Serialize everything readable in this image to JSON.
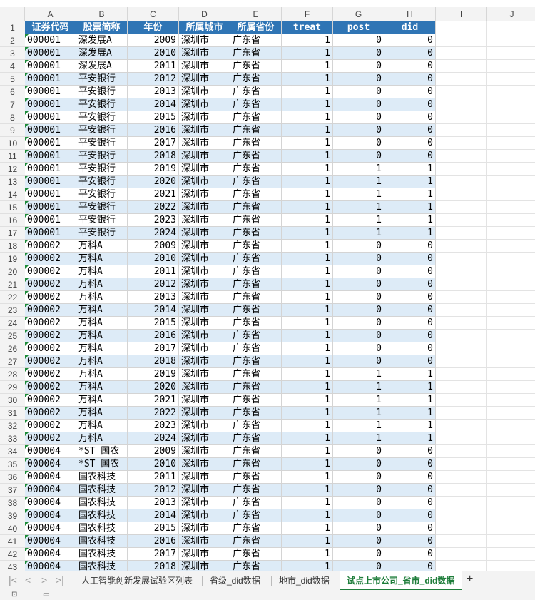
{
  "columns": [
    "A",
    "B",
    "C",
    "D",
    "E",
    "F",
    "G",
    "H",
    "I",
    "J"
  ],
  "headers": [
    "证券代码",
    "股票简称",
    "年份",
    "所属城市",
    "所属省份",
    "treat",
    "post",
    "did"
  ],
  "rows": [
    [
      "000001",
      "深发展A",
      "2009",
      "深圳市",
      "广东省",
      "1",
      "0",
      "0"
    ],
    [
      "000001",
      "深发展A",
      "2010",
      "深圳市",
      "广东省",
      "1",
      "0",
      "0"
    ],
    [
      "000001",
      "深发展A",
      "2011",
      "深圳市",
      "广东省",
      "1",
      "0",
      "0"
    ],
    [
      "000001",
      "平安银行",
      "2012",
      "深圳市",
      "广东省",
      "1",
      "0",
      "0"
    ],
    [
      "000001",
      "平安银行",
      "2013",
      "深圳市",
      "广东省",
      "1",
      "0",
      "0"
    ],
    [
      "000001",
      "平安银行",
      "2014",
      "深圳市",
      "广东省",
      "1",
      "0",
      "0"
    ],
    [
      "000001",
      "平安银行",
      "2015",
      "深圳市",
      "广东省",
      "1",
      "0",
      "0"
    ],
    [
      "000001",
      "平安银行",
      "2016",
      "深圳市",
      "广东省",
      "1",
      "0",
      "0"
    ],
    [
      "000001",
      "平安银行",
      "2017",
      "深圳市",
      "广东省",
      "1",
      "0",
      "0"
    ],
    [
      "000001",
      "平安银行",
      "2018",
      "深圳市",
      "广东省",
      "1",
      "0",
      "0"
    ],
    [
      "000001",
      "平安银行",
      "2019",
      "深圳市",
      "广东省",
      "1",
      "1",
      "1"
    ],
    [
      "000001",
      "平安银行",
      "2020",
      "深圳市",
      "广东省",
      "1",
      "1",
      "1"
    ],
    [
      "000001",
      "平安银行",
      "2021",
      "深圳市",
      "广东省",
      "1",
      "1",
      "1"
    ],
    [
      "000001",
      "平安银行",
      "2022",
      "深圳市",
      "广东省",
      "1",
      "1",
      "1"
    ],
    [
      "000001",
      "平安银行",
      "2023",
      "深圳市",
      "广东省",
      "1",
      "1",
      "1"
    ],
    [
      "000001",
      "平安银行",
      "2024",
      "深圳市",
      "广东省",
      "1",
      "1",
      "1"
    ],
    [
      "000002",
      "万科A",
      "2009",
      "深圳市",
      "广东省",
      "1",
      "0",
      "0"
    ],
    [
      "000002",
      "万科A",
      "2010",
      "深圳市",
      "广东省",
      "1",
      "0",
      "0"
    ],
    [
      "000002",
      "万科A",
      "2011",
      "深圳市",
      "广东省",
      "1",
      "0",
      "0"
    ],
    [
      "000002",
      "万科A",
      "2012",
      "深圳市",
      "广东省",
      "1",
      "0",
      "0"
    ],
    [
      "000002",
      "万科A",
      "2013",
      "深圳市",
      "广东省",
      "1",
      "0",
      "0"
    ],
    [
      "000002",
      "万科A",
      "2014",
      "深圳市",
      "广东省",
      "1",
      "0",
      "0"
    ],
    [
      "000002",
      "万科A",
      "2015",
      "深圳市",
      "广东省",
      "1",
      "0",
      "0"
    ],
    [
      "000002",
      "万科A",
      "2016",
      "深圳市",
      "广东省",
      "1",
      "0",
      "0"
    ],
    [
      "000002",
      "万科A",
      "2017",
      "深圳市",
      "广东省",
      "1",
      "0",
      "0"
    ],
    [
      "000002",
      "万科A",
      "2018",
      "深圳市",
      "广东省",
      "1",
      "0",
      "0"
    ],
    [
      "000002",
      "万科A",
      "2019",
      "深圳市",
      "广东省",
      "1",
      "1",
      "1"
    ],
    [
      "000002",
      "万科A",
      "2020",
      "深圳市",
      "广东省",
      "1",
      "1",
      "1"
    ],
    [
      "000002",
      "万科A",
      "2021",
      "深圳市",
      "广东省",
      "1",
      "1",
      "1"
    ],
    [
      "000002",
      "万科A",
      "2022",
      "深圳市",
      "广东省",
      "1",
      "1",
      "1"
    ],
    [
      "000002",
      "万科A",
      "2023",
      "深圳市",
      "广东省",
      "1",
      "1",
      "1"
    ],
    [
      "000002",
      "万科A",
      "2024",
      "深圳市",
      "广东省",
      "1",
      "1",
      "1"
    ],
    [
      "000004",
      "*ST 国农",
      "2009",
      "深圳市",
      "广东省",
      "1",
      "0",
      "0"
    ],
    [
      "000004",
      "*ST 国农",
      "2010",
      "深圳市",
      "广东省",
      "1",
      "0",
      "0"
    ],
    [
      "000004",
      "国农科技",
      "2011",
      "深圳市",
      "广东省",
      "1",
      "0",
      "0"
    ],
    [
      "000004",
      "国农科技",
      "2012",
      "深圳市",
      "广东省",
      "1",
      "0",
      "0"
    ],
    [
      "000004",
      "国农科技",
      "2013",
      "深圳市",
      "广东省",
      "1",
      "0",
      "0"
    ],
    [
      "000004",
      "国农科技",
      "2014",
      "深圳市",
      "广东省",
      "1",
      "0",
      "0"
    ],
    [
      "000004",
      "国农科技",
      "2015",
      "深圳市",
      "广东省",
      "1",
      "0",
      "0"
    ],
    [
      "000004",
      "国农科技",
      "2016",
      "深圳市",
      "广东省",
      "1",
      "0",
      "0"
    ],
    [
      "000004",
      "国农科技",
      "2017",
      "深圳市",
      "广东省",
      "1",
      "0",
      "0"
    ],
    [
      "000004",
      "国农科技",
      "2018",
      "深圳市",
      "广东省",
      "1",
      "0",
      "0"
    ]
  ],
  "tabs": [
    {
      "label": "人工智能创新发展试验区列表",
      "active": false
    },
    {
      "label": "省级_did数据",
      "active": false
    },
    {
      "label": "地市_did数据",
      "active": false
    },
    {
      "label": "试点上市公司_省市_did数据",
      "active": true
    }
  ],
  "nav_icons": [
    "first-sheet-icon",
    "prev-sheet-icon",
    "next-sheet-icon",
    "last-sheet-icon"
  ],
  "add_sheet_icon": "plus-icon",
  "colors": {
    "header_bg": "#2f75b5",
    "band": "#ddebf7",
    "active_tab": "#1e7d3a"
  }
}
